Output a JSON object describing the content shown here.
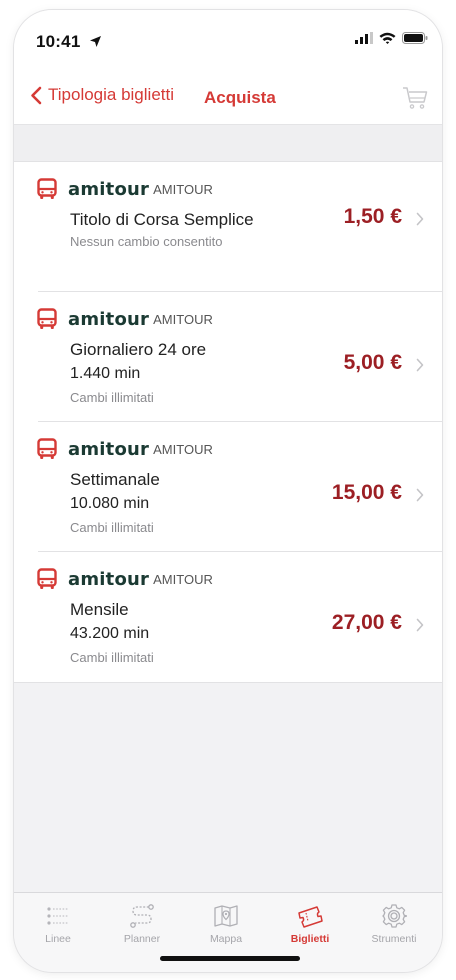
{
  "status": {
    "time": "10:41"
  },
  "nav": {
    "back_label": "Tipologia biglietti",
    "title": "Acquista"
  },
  "tickets": [
    {
      "logo": "amitour",
      "operator": "AMITOUR",
      "title": "Titolo di Corsa Semplice",
      "duration": "",
      "note": "Nessun cambio consentito",
      "price": "1,50 €"
    },
    {
      "logo": "amitour",
      "operator": "AMITOUR",
      "title": "Giornaliero 24 ore",
      "duration": "1.440 min",
      "note": "Cambi illimitati",
      "price": "5,00 €"
    },
    {
      "logo": "amitour",
      "operator": "AMITOUR",
      "title": "Settimanale",
      "duration": "10.080 min",
      "note": "Cambi illimitati",
      "price": "15,00 €"
    },
    {
      "logo": "amitour",
      "operator": "AMITOUR",
      "title": "Mensile",
      "duration": "43.200 min",
      "note": "Cambi illimitati",
      "price": "27,00 €"
    }
  ],
  "tabs": [
    {
      "label": "Linee",
      "icon": "lines-icon",
      "active": false
    },
    {
      "label": "Planner",
      "icon": "route-icon",
      "active": false
    },
    {
      "label": "Mappa",
      "icon": "map-icon",
      "active": false
    },
    {
      "label": "Biglietti",
      "icon": "ticket-icon",
      "active": true
    },
    {
      "label": "Strumenti",
      "icon": "gear-icon",
      "active": false
    }
  ],
  "colors": {
    "accent": "#d53a36",
    "price": "#9c1f24",
    "logo": "#1b3a33",
    "inactive": "#a5a5aa"
  }
}
